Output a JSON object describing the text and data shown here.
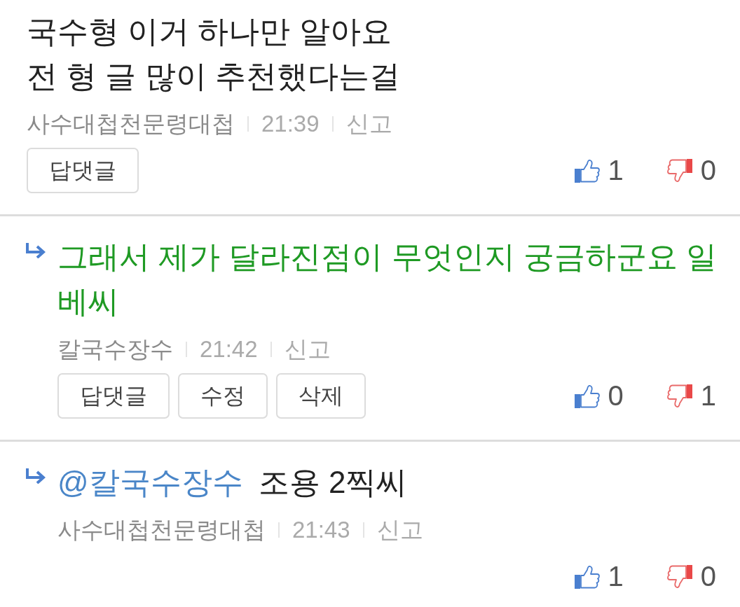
{
  "comments": [
    {
      "kind": "comment",
      "body": "국수형 이거 하나만 알아요\n전 형 글 많이 추천했다는걸",
      "color": "#222222",
      "author": "사수대첩천문령대첩",
      "time": "21:39",
      "report": "신고",
      "buttons": [
        "답댓글"
      ],
      "likes": "1",
      "dislikes": "0"
    },
    {
      "kind": "reply",
      "body": "그래서 제가 달라진점이 무엇인지 궁금하군요 일베씨",
      "color": "#1f9a24",
      "author": "칼국수장수",
      "time": "21:42",
      "report": "신고",
      "buttons": [
        "답댓글",
        "수정",
        "삭제"
      ],
      "likes": "0",
      "dislikes": "1"
    },
    {
      "kind": "reply",
      "mention": "@칼국수장수",
      "body": "조용 2찍씨",
      "color": "#222222",
      "author": "사수대첩천문령대첩",
      "time": "21:43",
      "report": "신고",
      "likes": "1",
      "dislikes": "0"
    }
  ]
}
